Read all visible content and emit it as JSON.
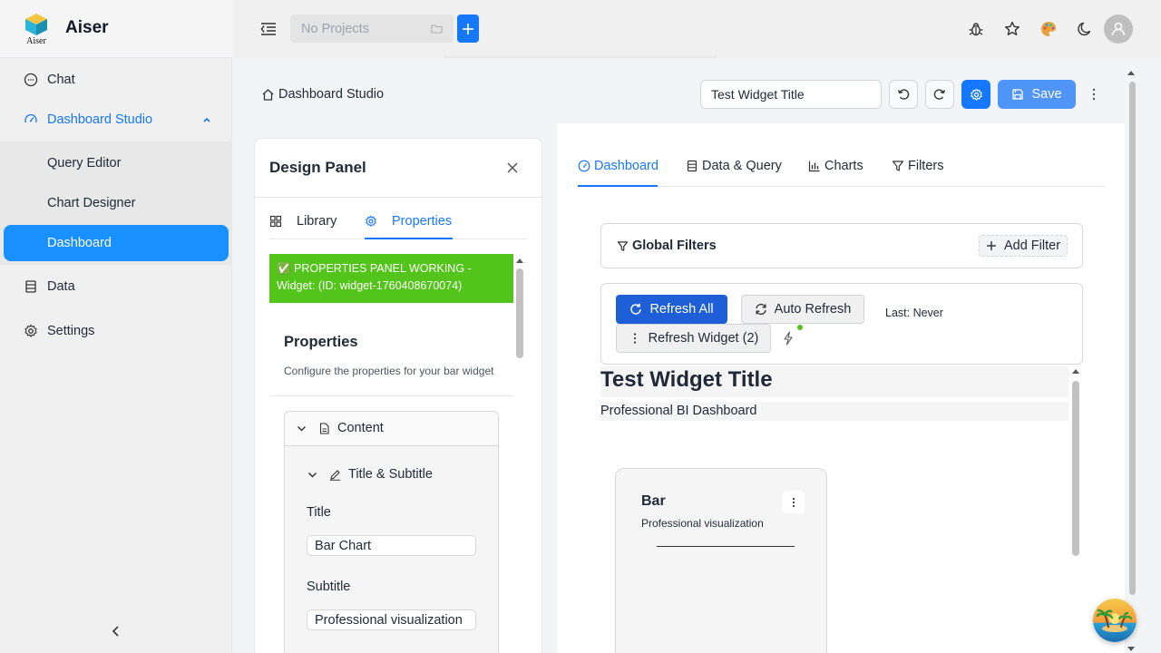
{
  "brand": {
    "name": "Aiser",
    "logo_text": "Aiser"
  },
  "sidebar": {
    "items": [
      {
        "label": "Chat",
        "icon": "chat-icon"
      },
      {
        "label": "Dashboard Studio",
        "icon": "dashboard-icon"
      },
      {
        "label": "Data",
        "icon": "database-icon"
      },
      {
        "label": "Settings",
        "icon": "gear-icon"
      }
    ],
    "subitems": [
      {
        "label": "Query Editor"
      },
      {
        "label": "Chart Designer"
      },
      {
        "label": "Dashboard"
      }
    ]
  },
  "topbar": {
    "project_placeholder": "No Projects",
    "icons": [
      "bug-icon",
      "star-icon",
      "palette-icon",
      "moon-icon"
    ]
  },
  "header": {
    "breadcrumb": "Dashboard Studio",
    "widget_title_value": "Test Widget Title",
    "save_label": "Save"
  },
  "design_panel": {
    "title": "Design Panel",
    "tabs": [
      {
        "label": "Library"
      },
      {
        "label": "Properties",
        "active": true
      }
    ],
    "banner": "✅ PROPERTIES PANEL WORKING - Widget: (ID: widget-1760408670074)",
    "properties_title": "Properties",
    "properties_desc": "Configure the properties for your bar widget",
    "content_section": "Content",
    "title_subtitle_section": "Title & Subtitle",
    "title_label": "Title",
    "title_value": "Bar Chart",
    "subtitle_label": "Subtitle",
    "subtitle_value": "Professional visualization"
  },
  "dashboard": {
    "tabs": [
      {
        "label": "Dashboard",
        "active": true
      },
      {
        "label": "Data & Query"
      },
      {
        "label": "Charts"
      },
      {
        "label": "Filters"
      }
    ],
    "global_filters": "Global Filters",
    "add_filter": "Add Filter",
    "refresh_all": "Refresh All",
    "auto_refresh": "Auto Refresh",
    "last_refresh": "Last: Never",
    "refresh_widget": "Refresh Widget (2)",
    "widget_title": "Test Widget Title",
    "widget_subtitle": "Professional BI Dashboard",
    "bar_card": {
      "title": "Bar",
      "subtitle": "Professional visualization"
    }
  },
  "colors": {
    "accent": "#1677ff",
    "active_nav": "#1890ff",
    "banner_green": "#52c41a",
    "refresh_blue": "#1e5fd8"
  }
}
